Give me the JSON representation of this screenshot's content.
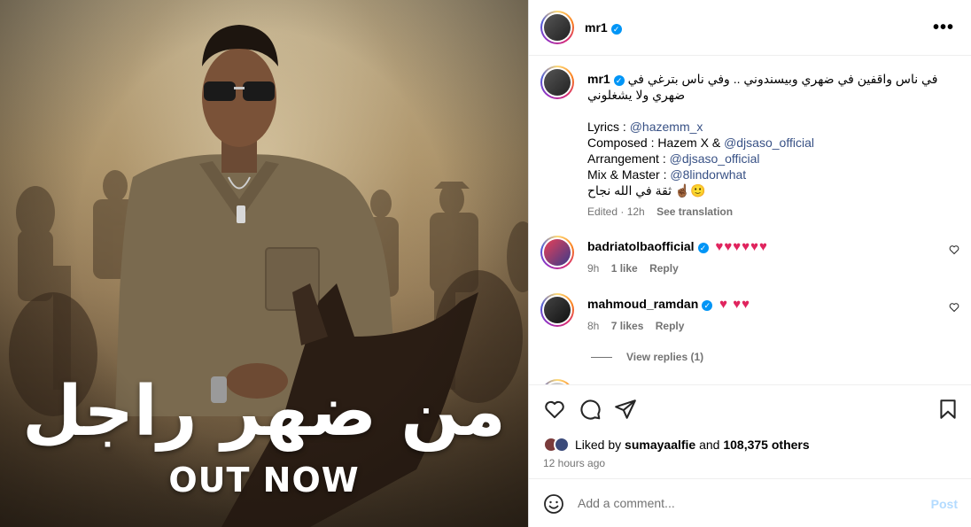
{
  "post": {
    "username": "mr1",
    "more_label": "•••",
    "media": {
      "title_arabic": "من ضهر راجل",
      "title_english": "OUT NOW"
    }
  },
  "caption": {
    "username": "mr1",
    "line1": "في ناس واقفين في ضهري وبيسندوني .. وفي ناس بترغي في ضهري ولا يشغلوني",
    "lyrics_label": "Lyrics : ",
    "lyrics_handle": "@hazemm_x",
    "composed_label": "Composed : Hazem X & ",
    "composed_handle": "@djsaso_official",
    "arrangement_label": "Arrangement : ",
    "arrangement_handle": "@djsaso_official",
    "mix_label": "Mix & Master : ",
    "mix_handle": "@8lindorwhat",
    "closing": "ثقة في الله نجاح ☝🏾🙂",
    "edited": "Edited · 12h",
    "see_translation": "See translation"
  },
  "comments": [
    {
      "username": "badriatolbaofficial",
      "text": "♥♥♥♥♥♥",
      "time": "9h",
      "likes": "1 like",
      "reply": "Reply"
    },
    {
      "username": "mahmoud_ramdan",
      "text": "♥ ♥♥",
      "time": "8h",
      "likes": "7 likes",
      "reply": "Reply"
    }
  ],
  "view_replies": "View replies (1)",
  "likes": {
    "prefix": "Liked by ",
    "user": "sumayaalfie",
    "middle": " and ",
    "count": "108,375 others"
  },
  "timestamp": "12 hours ago",
  "add_comment": {
    "placeholder": "Add a comment...",
    "post_label": "Post"
  },
  "icons": {
    "like": "heart-icon",
    "comment": "comment-icon",
    "share": "share-icon",
    "save": "bookmark-icon",
    "emoji": "emoji-icon",
    "more": "more-icon"
  },
  "colors": {
    "link": "#385185",
    "verified": "#0095f6",
    "post_disabled": "#b3dbff",
    "heart": "#e0245e"
  }
}
